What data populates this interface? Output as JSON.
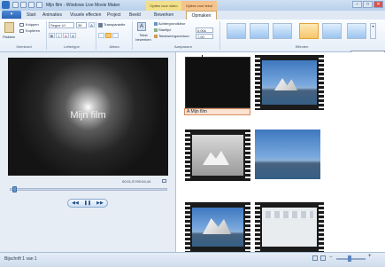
{
  "window": {
    "title": "Mijn film - Windows Live Movie Maker",
    "controls": {
      "minimize": "–",
      "maximize": "□",
      "close": "✕"
    }
  },
  "contextual_tabs": {
    "video_tools": "Opties voor video",
    "text_tools": "Opties voor tekst"
  },
  "tabs": {
    "file": "▾",
    "items": [
      "Start",
      "Animaties",
      "Visuele effecten",
      "Project",
      "Beeld",
      "Bewerken",
      "Opmaken"
    ],
    "active": "Opmaken"
  },
  "ribbon": {
    "clipboard": {
      "label": "Klembord",
      "paste": "Plakken",
      "cut": "Knippen",
      "copy": "Kopiëren"
    },
    "font": {
      "label": "Lettertype",
      "family": "Segoe UI",
      "size": "36",
      "bold": "B",
      "italic": "I",
      "underline": "A",
      "grow": "A",
      "shrink": "A"
    },
    "paragraph": {
      "label": "Alinea",
      "transparency": "Transparantie"
    },
    "adjust": {
      "label": "Aanpassen",
      "edit_text": "Tekst bewerken",
      "background_color": "Achtergrondkleur",
      "start_time": "Starttijd:",
      "start_time_value": "0,00s",
      "text_duration": "Tekstweergaveduur:",
      "text_duration_value": "7,00"
    },
    "effects": {
      "label": "Effecten",
      "selected_index": 4
    },
    "colors": {
      "accent": "#2b63b3",
      "selected_effect": "#f6c66a"
    }
  },
  "tooltip": "Filmkunst - uitzoomen",
  "preview": {
    "caption": "Mijn film",
    "timecode": "00:01,57/00:54,44",
    "seek_progress": 0.03,
    "buttons": {
      "previous": "◀◀",
      "play": "❚❚",
      "next": "▶▶"
    }
  },
  "storyboard": {
    "text_caption": "A Mijn film"
  },
  "statusbar": {
    "status": "Bijschrift 1 van 1",
    "zoom_out": "−",
    "zoom_in": "+"
  }
}
